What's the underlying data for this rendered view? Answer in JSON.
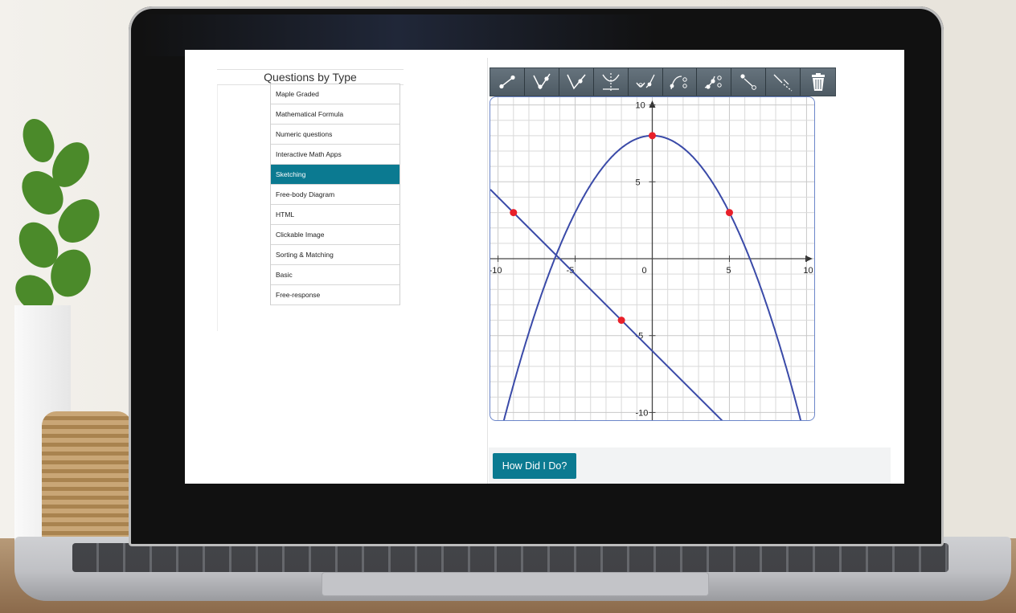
{
  "sidebar": {
    "heading": "Questions by Type",
    "items": [
      {
        "label": "Maple Graded"
      },
      {
        "label": "Mathematical Formula"
      },
      {
        "label": "Numeric questions"
      },
      {
        "label": "Interactive Math Apps"
      },
      {
        "label": "Sketching",
        "active": true
      },
      {
        "label": "Free-body Diagram"
      },
      {
        "label": "HTML"
      },
      {
        "label": "Clickable Image"
      },
      {
        "label": "Sorting & Matching"
      },
      {
        "label": "Basic"
      },
      {
        "label": "Free-response"
      }
    ]
  },
  "toolbar": {
    "tools": [
      {
        "icon": "line-segment-icon"
      },
      {
        "icon": "ray-icon"
      },
      {
        "icon": "polyline-icon"
      },
      {
        "icon": "asymptote-icon"
      },
      {
        "icon": "parabola-icon"
      },
      {
        "icon": "curve-point-icon"
      },
      {
        "icon": "multi-point-icon"
      },
      {
        "icon": "point-icon"
      },
      {
        "icon": "dashed-line-icon"
      },
      {
        "icon": "trash-icon"
      }
    ]
  },
  "chart_data": {
    "type": "line",
    "xlim": [
      -10.5,
      10.5
    ],
    "ylim": [
      -10.5,
      10.5
    ],
    "grid": true,
    "x_tick_labels": [
      "-10",
      "-5",
      "0",
      "5",
      "10"
    ],
    "y_tick_labels": [
      "10",
      "5",
      "-5",
      "-10"
    ],
    "series": [
      {
        "kind": "parabola",
        "vertex": [
          0,
          8
        ],
        "points": [
          [
            5,
            3
          ]
        ]
      },
      {
        "kind": "line",
        "points": [
          [
            -9,
            3
          ],
          [
            -2,
            -4
          ]
        ]
      }
    ],
    "points": [
      {
        "x": 0,
        "y": 8
      },
      {
        "x": 5,
        "y": 3
      },
      {
        "x": -9,
        "y": 3
      },
      {
        "x": -2,
        "y": -4
      }
    ],
    "colors": {
      "curve": "#3a4aa8",
      "point": "#e8202a",
      "grid": "#d9d9d9"
    }
  },
  "actions": {
    "submit_label": "How Did I Do?"
  },
  "colors": {
    "accent": "#0b7a91",
    "toolbar": "#51606b"
  }
}
